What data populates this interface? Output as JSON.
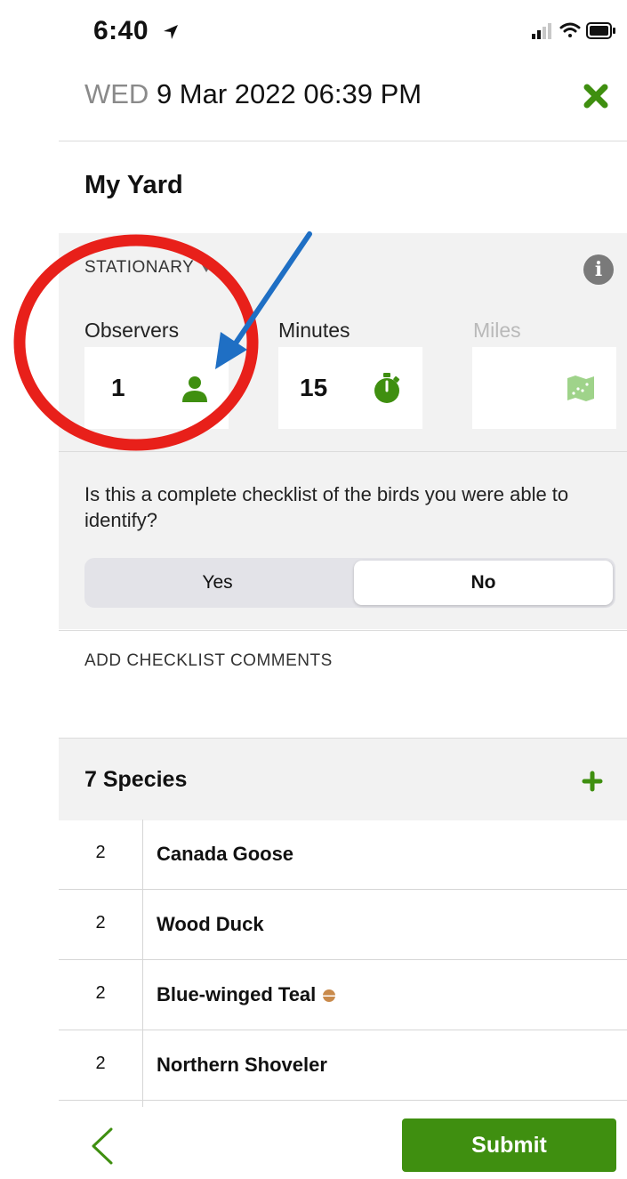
{
  "status_bar": {
    "time": "6:40"
  },
  "header": {
    "day_of_week": "WED",
    "datetime": "9 Mar 2022 06:39 PM"
  },
  "location": {
    "name": "My Yard"
  },
  "details": {
    "protocol": "STATIONARY",
    "fields": [
      {
        "label": "Observers",
        "value": "1",
        "icon": "person-icon"
      },
      {
        "label": "Minutes",
        "value": "15",
        "icon": "stopwatch-icon"
      },
      {
        "label": "Miles",
        "value": "",
        "icon": "map-icon"
      }
    ],
    "complete_question": "Is this a complete checklist of the birds you were able to identify?",
    "complete_options": {
      "yes": "Yes",
      "no": "No",
      "selected": "No"
    }
  },
  "comments": {
    "label": "ADD CHECKLIST COMMENTS"
  },
  "species": {
    "title": "7 Species",
    "items": [
      {
        "count": "2",
        "name": "Canada Goose"
      },
      {
        "count": "2",
        "name": "Wood Duck"
      },
      {
        "count": "2",
        "name": "Blue-winged Teal",
        "badge": true
      },
      {
        "count": "2",
        "name": "Northern Shoveler"
      }
    ]
  },
  "footer": {
    "submit": "Submit"
  },
  "colors": {
    "accent": "#3f8f10",
    "annotation_circle": "#e8201a",
    "annotation_arrow": "#1f6fc4"
  }
}
